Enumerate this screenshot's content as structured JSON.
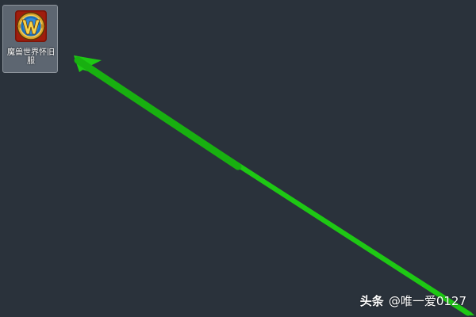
{
  "desktop": {
    "background_color": "#2a323b",
    "shortcuts": [
      {
        "label": "魔兽世界怀旧服",
        "icon": "warcraft-w-logo-icon",
        "selected": true
      }
    ]
  },
  "annotation": {
    "type": "pointer-arrow",
    "color": "#1ec814"
  },
  "watermark": {
    "brand": "头条",
    "handle": "@唯一爱0127"
  }
}
